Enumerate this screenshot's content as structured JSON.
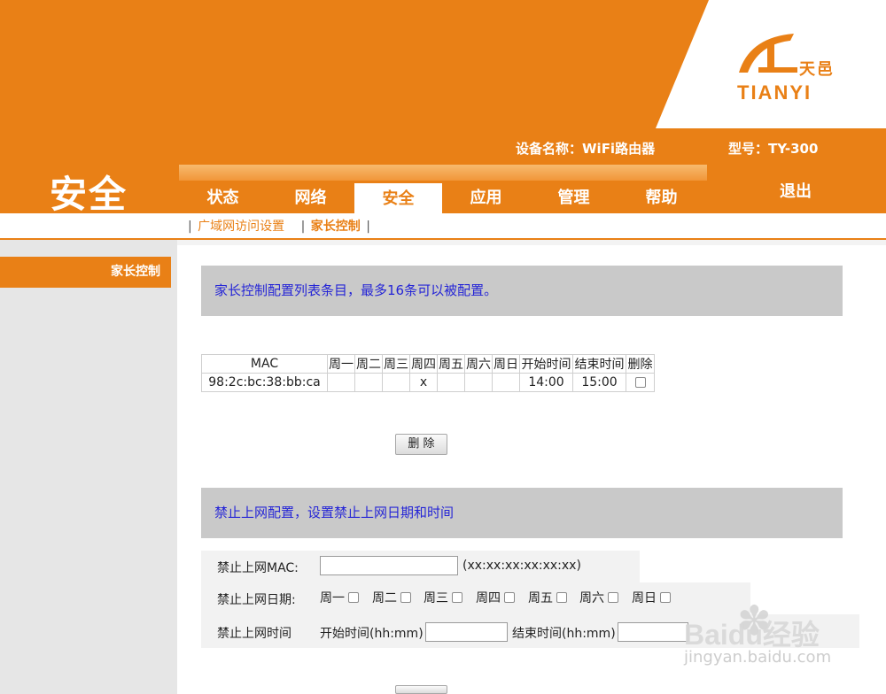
{
  "brand": {
    "cn": "天邑",
    "en": "TIANYI"
  },
  "header": {
    "device_name": "设备名称：WiFi路由器",
    "model": "型号：TY-300",
    "logout": "退出",
    "section_title": "安全"
  },
  "nav": {
    "tabs": [
      {
        "label": "状态"
      },
      {
        "label": "网络"
      },
      {
        "label": "安全",
        "active": true
      },
      {
        "label": "应用"
      },
      {
        "label": "管理"
      },
      {
        "label": "帮助"
      }
    ]
  },
  "subnav": {
    "items": [
      {
        "label": "广域网访问设置"
      },
      {
        "label": "家长控制",
        "active": true
      }
    ],
    "separator": "|"
  },
  "sidebar": {
    "items": [
      {
        "label": "家长控制",
        "active": true
      }
    ]
  },
  "list_section": {
    "info": "家长控制配置列表条目，最多16条可以被配置。",
    "columns": [
      "MAC",
      "周一",
      "周二",
      "周三",
      "周四",
      "周五",
      "周六",
      "周日",
      "开始时间",
      "结束时间",
      "删除"
    ],
    "rows": [
      {
        "mac": "98:2c:bc:38:bb:ca",
        "mon": "",
        "tue": "",
        "wed": "",
        "thu": "x",
        "fri": "",
        "sat": "",
        "sun": "",
        "start": "14:00",
        "end": "15:00",
        "delete_checked": false
      }
    ],
    "delete_button": "删 除"
  },
  "form_section": {
    "info": "禁止上网配置，设置禁止上网日期和时间",
    "mac_label": "禁止上网MAC:",
    "mac_value": "",
    "mac_hint": "(xx:xx:xx:xx:xx:xx)",
    "date_label": "禁止上网日期:",
    "days": [
      "周一",
      "周二",
      "周三",
      "周四",
      "周五",
      "周六",
      "周日"
    ],
    "time_label": "禁止上网时间",
    "start_label": "开始时间(hh:mm)",
    "start_value": "",
    "end_label": "结束时间(hh:mm)",
    "end_value": ""
  },
  "watermark": {
    "text": "Baidu经验",
    "url": "jingyan.baidu.com"
  },
  "colors": {
    "accent": "#e98016",
    "info_bar": "#c9c9c9",
    "info_text": "#2525d6"
  }
}
